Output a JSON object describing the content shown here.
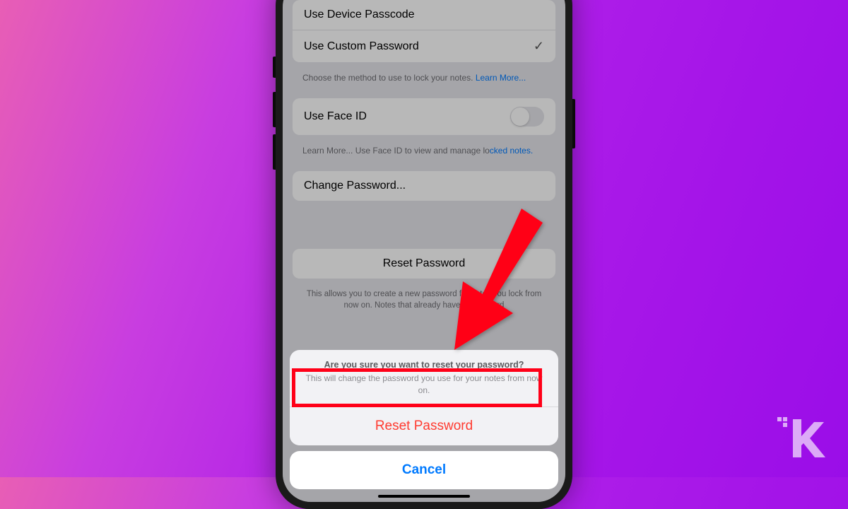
{
  "settings": {
    "items": [
      {
        "label": "Use Device Passcode"
      },
      {
        "label": "Use Custom Password",
        "checked": true
      }
    ],
    "footer_text": "Choose the method to use to lock your notes. ",
    "footer_link": "Learn More...",
    "faceid": {
      "label": "Use Face ID",
      "footer_prefix": "Learn More... Use Face ID to view and manage lo",
      "footer_link": "cked notes."
    },
    "change_password_label": "Change Password...",
    "reset_password_label": "Reset Password",
    "reset_footer": "This allows you to create a new password for notes you lock from now on. Notes that already have a password"
  },
  "action_sheet": {
    "title": "Are you sure you want to reset your password?",
    "subtitle": "This will change the password you use for your notes from now on.",
    "destructive_label": "Reset Password",
    "cancel_label": "Cancel"
  },
  "annotation": {
    "arrow_color": "#ff0018"
  }
}
